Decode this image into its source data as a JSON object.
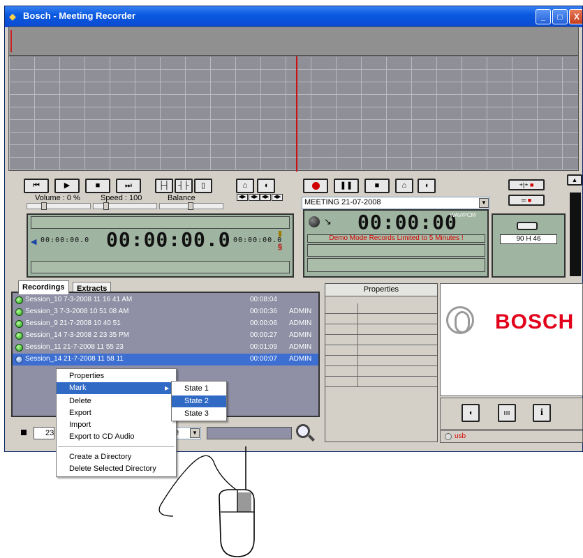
{
  "window": {
    "title": "Bosch - Meeting Recorder",
    "title_buttons": {
      "minimize": "_",
      "maximize": "□",
      "close": "X"
    }
  },
  "playback": {
    "volume_label": "Volume : 0 %",
    "speed_label": "Speed : 100",
    "balance_label": "Balance",
    "time_main": "00:00:00.0",
    "time_left": "00:00:00.0",
    "time_right": "00:00:00.0",
    "buttons": [
      "⏮",
      "▶",
      "■",
      "⏭"
    ]
  },
  "recorder": {
    "meeting_name": "MEETING 21-07-2008",
    "time": "00:00:00",
    "format": "WAV/PCM",
    "demo_message": "Demo Mode Records Limited to 5 Minutes !",
    "disk_free": "90 H 46"
  },
  "tabs": {
    "recordings": "Recordings",
    "extracts": "Extracts"
  },
  "recordings": [
    {
      "name": "Session_10  7-3-2008 11 16 41 AM",
      "duration": "00:08:04",
      "user": ""
    },
    {
      "name": "Session_3  7-3-2008 10 51 08 AM",
      "duration": "00:00:36",
      "user": "ADMIN"
    },
    {
      "name": "Session_9  21-7-2008 10 40 51",
      "duration": "00:00:06",
      "user": "ADMIN"
    },
    {
      "name": "Session_14  7-3-2008 2 23 35 PM",
      "duration": "00:00:27",
      "user": "ADMIN"
    },
    {
      "name": "Session_11  21-7-2008 11 55 23",
      "duration": "00:01:09",
      "user": "ADMIN"
    },
    {
      "name": "Session_14  21-7-2008 11 58 11",
      "duration": "00:00:07",
      "user": "ADMIN"
    }
  ],
  "properties": {
    "header": "Properties"
  },
  "brand": {
    "name": "BOSCH",
    "color": "#e2001a"
  },
  "status": {
    "usb": "usb"
  },
  "bottom": {
    "field_value": "23",
    "combo_value": "e"
  },
  "context_menu": {
    "items": [
      "Properties",
      "Mark",
      "Delete",
      "Export",
      "Import",
      "Export to CD Audio",
      "Create a Directory",
      "Delete Selected Directory"
    ],
    "submenu": [
      "State 1",
      "State 2",
      "State 3"
    ]
  },
  "colors": {
    "accent": "#316ac5",
    "list_bg": "#8f8fa5",
    "lcd": "#9fb4a1",
    "demo_red": "#d40000"
  }
}
